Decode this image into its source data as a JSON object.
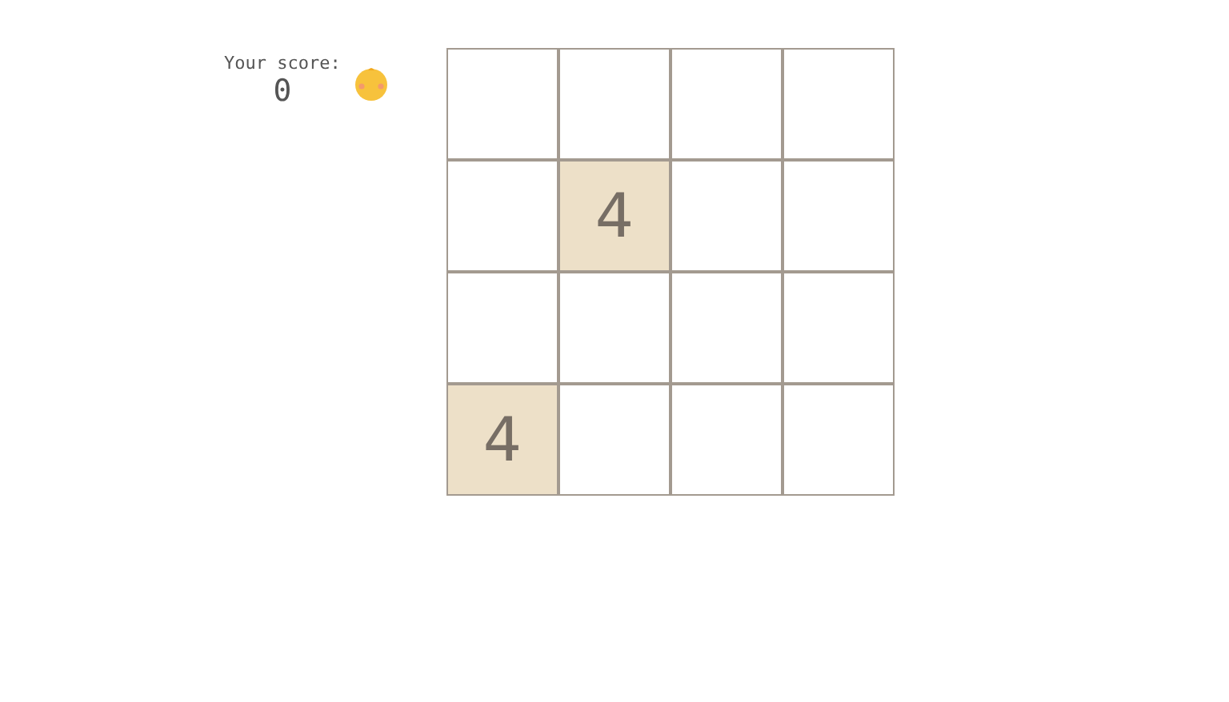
{
  "score": {
    "label": "Your score:",
    "value": "0"
  },
  "board": {
    "rows": [
      [
        {
          "kind": "empty"
        },
        {
          "kind": "empty"
        },
        {
          "kind": "empty"
        },
        {
          "kind": "empty"
        }
      ],
      [
        {
          "kind": "empty"
        },
        {
          "kind": "tile",
          "value": "4"
        },
        {
          "kind": "empty"
        },
        {
          "kind": "empty"
        }
      ],
      [
        {
          "kind": "empty"
        },
        {
          "kind": "empty"
        },
        {
          "kind": "empty"
        },
        {
          "kind": "empty"
        }
      ],
      [
        {
          "kind": "tile",
          "value": "4"
        },
        {
          "kind": "empty"
        },
        {
          "kind": "empty"
        },
        {
          "kind": "empty"
        }
      ]
    ]
  }
}
